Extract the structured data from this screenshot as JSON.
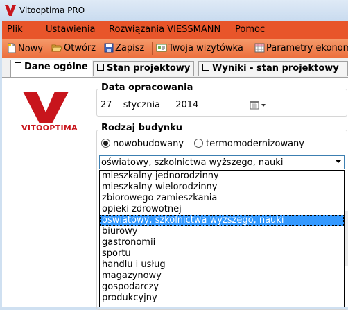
{
  "window": {
    "title": "Vitooptima PRO"
  },
  "menu": [
    {
      "label": "Plik",
      "underline": "P",
      "rest": "lik"
    },
    {
      "label": "Ustawienia",
      "underline": "U",
      "rest": "stawienia"
    },
    {
      "label": "Rozwiązania VIESSMANN",
      "underline": "R",
      "rest": "ozwiązania VIESSMANN"
    },
    {
      "label": "Pomoc",
      "underline": "P",
      "rest": "omoc"
    }
  ],
  "toolbar": {
    "new_label": "Nowy",
    "open_label": "Otwórz",
    "save_label": "Zapisz",
    "card_label": "Twoja wizytówka",
    "params_label": "Parametry ekonom"
  },
  "tabs": [
    {
      "label": "Dane ogólne",
      "active": true
    },
    {
      "label": "Stan projektowy",
      "active": false
    },
    {
      "label": "Wyniki - stan projektowy",
      "active": false
    }
  ],
  "logo": {
    "text": "VITOOPTIMA",
    "color": "#c8151c"
  },
  "date_section": {
    "title": "Data opracowania",
    "day": "27",
    "month": "stycznia",
    "year": "2014"
  },
  "building_section": {
    "title": "Rodzaj budynku",
    "radio_new": {
      "label": "nowobudowany",
      "checked": true
    },
    "radio_thermo": {
      "label": "termomodernizowany",
      "checked": false
    },
    "combo_value": "oświatowy, szkolnictwa wyższego, nauki",
    "options": [
      "mieszkalny jednorodzinny",
      "mieszkalny wielorodzinny",
      "zbiorowego zamieszkania",
      "opieki zdrowotnej",
      "oświatowy, szkolnictwa wyższego, nauki",
      "biurowy",
      "gastronomii",
      "sportu",
      "handlu i usług",
      "magazynowy",
      "gospodarczy",
      "produkcyjny"
    ],
    "selected_index": 4
  },
  "colors": {
    "menu_bg": "#e8552a",
    "selection": "#3399ff",
    "accent": "#c8151c"
  }
}
